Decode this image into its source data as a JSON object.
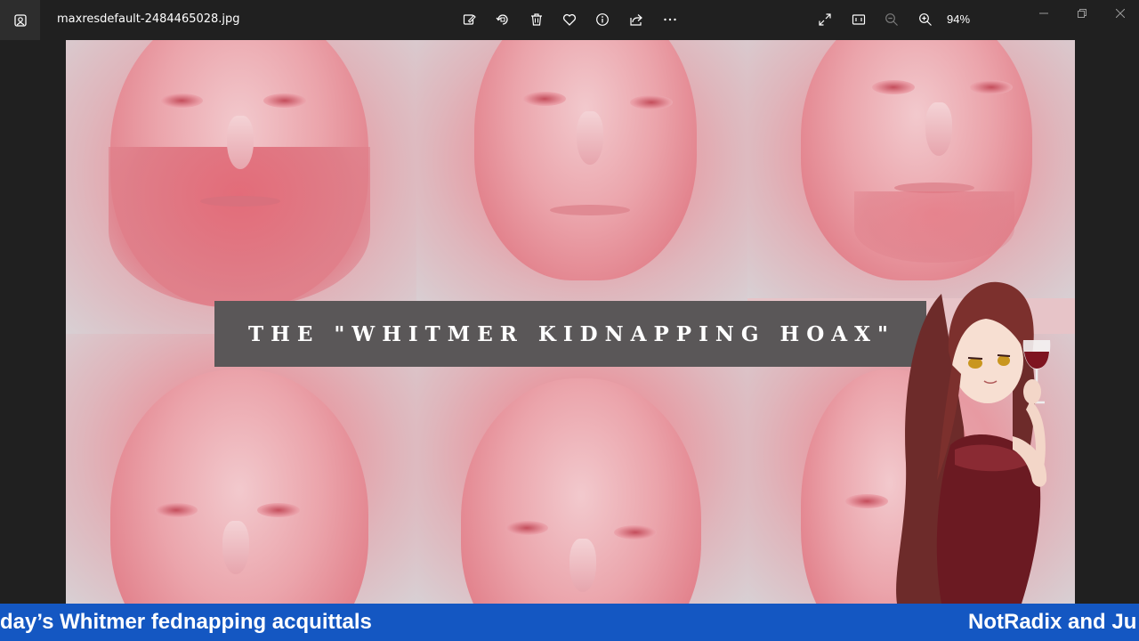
{
  "titlebar": {
    "filename": "maxresdefault-2484465028.jpg",
    "zoom": "94%",
    "icons": {
      "app": "photos-app-icon",
      "edit": "edit-image-icon",
      "rotate": "rotate-icon",
      "delete": "delete-icon",
      "favorite": "heart-icon",
      "info": "info-icon",
      "share": "share-icon",
      "more": "more-icon",
      "fullscreen": "fullscreen-icon",
      "actual_size": "actual-size-icon",
      "zoom_out": "zoom-out-icon",
      "zoom_in": "zoom-in-icon"
    }
  },
  "image": {
    "banner_text": "THE \"WHITMER KIDNAPPING HOAX\"",
    "tint_color": "#e7949c",
    "banner_color": "#5a5758"
  },
  "ticker": {
    "left_text": "day’s Whitmer fednapping acquittals",
    "right_text": "NotRadix and Ju",
    "background": "#1457c2"
  }
}
